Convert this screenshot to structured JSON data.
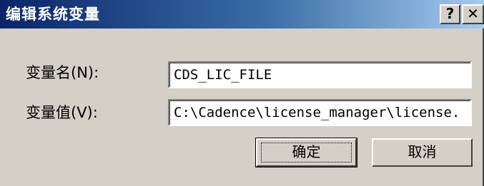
{
  "window": {
    "title": "编辑系统变量",
    "help_label": "?",
    "close_label": "✕"
  },
  "form": {
    "name_label": "变量名(N):",
    "name_value": "CDS_LIC_FILE",
    "value_label": "变量值(V):",
    "value_value": "C:\\Cadence\\license_manager\\license."
  },
  "buttons": {
    "ok_label": "确定",
    "cancel_label": "取消"
  },
  "colors": {
    "titlebar_start": "#0a246a",
    "titlebar_end": "#a6caf0",
    "face": "#d4d0c8"
  }
}
